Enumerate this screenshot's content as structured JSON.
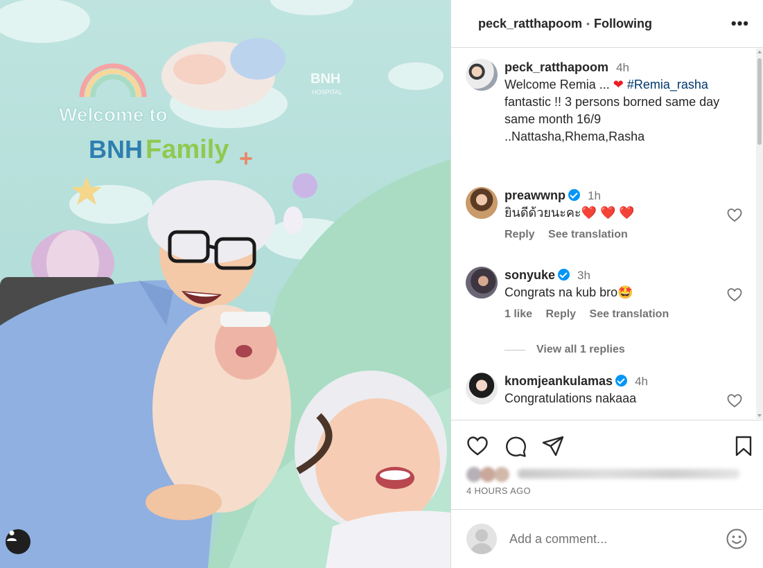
{
  "photo": {
    "wall_welcome": "Welcome to",
    "wall_brand": "BNH",
    "wall_family": "Family",
    "wall_plus": "+",
    "logo_text": "BNH",
    "logo_sub": "HOSPITAL"
  },
  "header": {
    "username": "peck_ratthapoom",
    "separator": "•",
    "follow_label": "Following",
    "more_label": "•••"
  },
  "caption": {
    "username": "peck_ratthapoom",
    "time": "4h",
    "line1": "Welcome Remia ...",
    "hashtag": "#Remia_rasha",
    "line2": "fantastic !! 3 persons borned same day same month 16/9",
    "line3": "..Nattasha,Rhema,Rasha"
  },
  "comments": [
    {
      "username": "preawwnp",
      "verified": true,
      "time": "1h",
      "text": "ยินดีด้วยนะคะ",
      "hearts": "❤️ ❤️ ❤️",
      "reply_label": "Reply",
      "translate_label": "See translation"
    },
    {
      "username": "sonyuke",
      "verified": true,
      "time": "3h",
      "text": "Congrats na kub bro",
      "emoji": "🤩",
      "likes_label": "1 like",
      "reply_label": "Reply",
      "translate_label": "See translation",
      "view_replies": "View all 1 replies"
    },
    {
      "username": "knomjeankulamas",
      "verified": true,
      "time": "4h",
      "text": "Congratulations nakaaa"
    }
  ],
  "footer": {
    "posted_time": "4 HOURS AGO",
    "comment_placeholder": "Add a comment..."
  },
  "colors": {
    "verified": "#0095f6",
    "hashtag": "#00376b",
    "heart": "#ed1c24",
    "muted": "#737373"
  }
}
